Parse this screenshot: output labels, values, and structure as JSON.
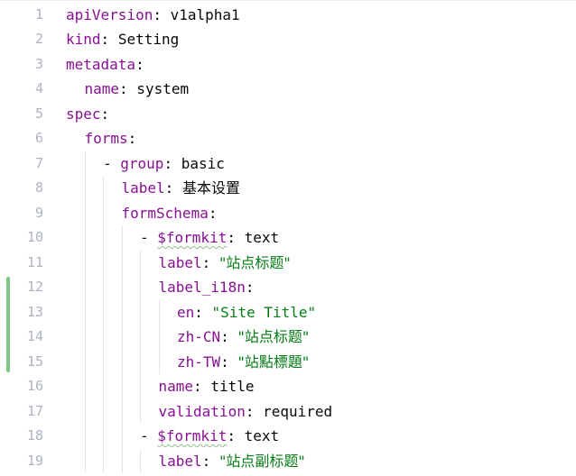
{
  "editor": {
    "language": "yaml",
    "colors": {
      "key": "#871094",
      "string": "#067d17",
      "plain": "#080808",
      "line_number": "#aeb3c2",
      "change_marker": "#7ec483"
    },
    "changed_lines": [
      12,
      13,
      14,
      15
    ],
    "lines": [
      {
        "num": "1",
        "indent": 0,
        "dash": false,
        "key": "apiVersion",
        "value": "v1alpha1",
        "value_type": "plain"
      },
      {
        "num": "2",
        "indent": 0,
        "dash": false,
        "key": "kind",
        "value": "Setting",
        "value_type": "plain"
      },
      {
        "num": "3",
        "indent": 0,
        "dash": false,
        "key": "metadata",
        "value": "",
        "value_type": "plain"
      },
      {
        "num": "4",
        "indent": 1,
        "dash": false,
        "key": "name",
        "value": "system",
        "value_type": "plain"
      },
      {
        "num": "5",
        "indent": 0,
        "dash": false,
        "key": "spec",
        "value": "",
        "value_type": "plain"
      },
      {
        "num": "6",
        "indent": 1,
        "dash": false,
        "key": "forms",
        "value": "",
        "value_type": "plain"
      },
      {
        "num": "7",
        "indent": 2,
        "dash": true,
        "key": "group",
        "value": "basic",
        "value_type": "plain"
      },
      {
        "num": "8",
        "indent": 3,
        "dash": false,
        "key": "label",
        "value": "基本设置",
        "value_type": "plain"
      },
      {
        "num": "9",
        "indent": 3,
        "dash": false,
        "key": "formSchema",
        "value": "",
        "value_type": "plain"
      },
      {
        "num": "10",
        "indent": 4,
        "dash": true,
        "key": "$formkit",
        "value": "text",
        "value_type": "plain",
        "wavy": true
      },
      {
        "num": "11",
        "indent": 5,
        "dash": false,
        "key": "label",
        "value": "\"站点标题\"",
        "value_type": "string"
      },
      {
        "num": "12",
        "indent": 5,
        "dash": false,
        "key": "label_i18n",
        "value": "",
        "value_type": "plain"
      },
      {
        "num": "13",
        "indent": 6,
        "dash": false,
        "key": "en",
        "value": "\"Site Title\"",
        "value_type": "string"
      },
      {
        "num": "14",
        "indent": 6,
        "dash": false,
        "key": "zh-CN",
        "value": "\"站点标题\"",
        "value_type": "string"
      },
      {
        "num": "15",
        "indent": 6,
        "dash": false,
        "key": "zh-TW",
        "value": "\"站點標題\"",
        "value_type": "string"
      },
      {
        "num": "16",
        "indent": 5,
        "dash": false,
        "key": "name",
        "value": "title",
        "value_type": "plain"
      },
      {
        "num": "17",
        "indent": 5,
        "dash": false,
        "key": "validation",
        "value": "required",
        "value_type": "plain"
      },
      {
        "num": "18",
        "indent": 4,
        "dash": true,
        "key": "$formkit",
        "value": "text",
        "value_type": "plain",
        "wavy": true
      },
      {
        "num": "19",
        "indent": 5,
        "dash": false,
        "key": "label",
        "value": "\"站点副标题\"",
        "value_type": "string"
      }
    ]
  }
}
